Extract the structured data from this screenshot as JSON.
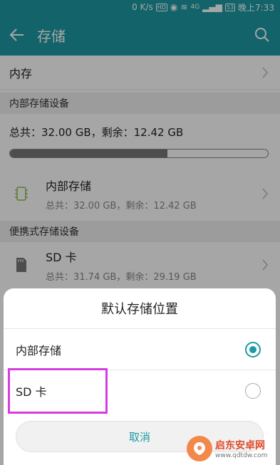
{
  "status_bar": {
    "net_speed": "0 K/s",
    "hd": "HD",
    "signal_4g": "4G",
    "battery": "53",
    "time": "晚上7:33"
  },
  "header": {
    "title": "存储"
  },
  "memory": {
    "label": "内存"
  },
  "internal_section": {
    "title": "内部存储设备",
    "total_line": "总共：32.00 GB，剩余：12.42 GB",
    "usage_fraction": 0.61
  },
  "devices": [
    {
      "name": "内部存储",
      "detail": "总共：32.00 GB，剩余：12.42 GB"
    },
    {
      "name": "SD 卡",
      "detail": "总共：31.74 GB，剩余：29.19 GB"
    }
  ],
  "portable_section": {
    "title": "便携式存储设备"
  },
  "dialog": {
    "title": "默认存储位置",
    "options": [
      {
        "label": "内部存储",
        "selected": true
      },
      {
        "label": "SD 卡",
        "selected": false
      }
    ],
    "cancel": "取消"
  },
  "watermark": {
    "line1": "启东安卓网",
    "line2": "www.qdtdw.com"
  },
  "colors": {
    "accent": "#1d9aa3",
    "highlight": "#d63ce0"
  }
}
